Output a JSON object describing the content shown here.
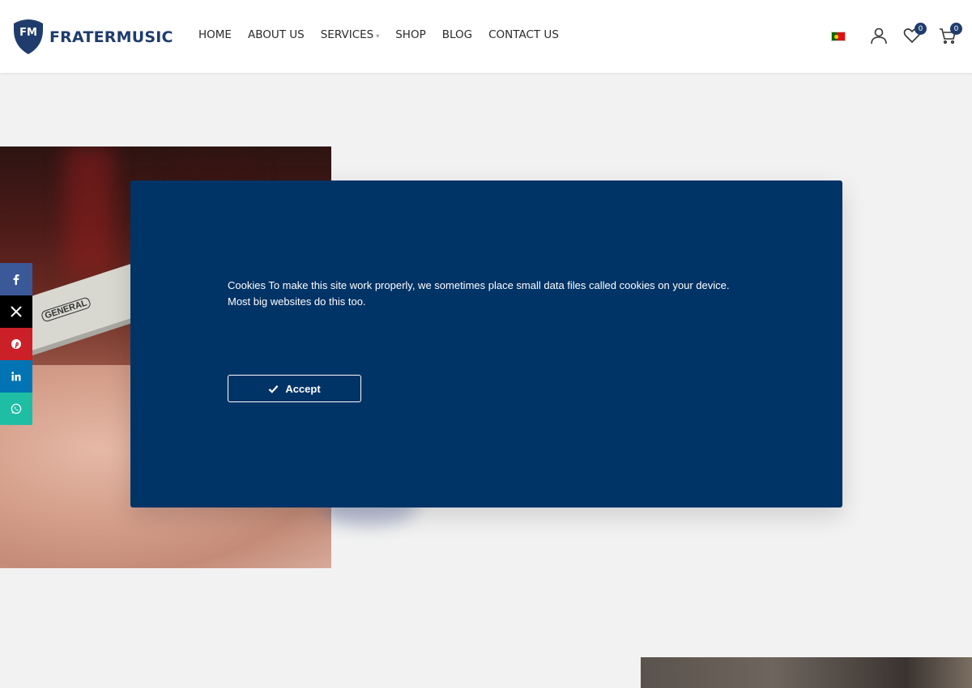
{
  "brand": {
    "name": "FRATERMUSIC",
    "mark": "FM",
    "color": "#1f3c6d"
  },
  "nav": {
    "items": [
      {
        "label": "HOME"
      },
      {
        "label": "ABOUT US"
      },
      {
        "label": "SERVICES",
        "has_dropdown": true
      },
      {
        "label": "SHOP"
      },
      {
        "label": "BLOG"
      },
      {
        "label": "CONTACT US"
      }
    ]
  },
  "header_icons": {
    "language_flag": "portugal-flag-icon",
    "account": "user-icon",
    "wishlist": {
      "icon": "heart-icon",
      "count": "0"
    },
    "cart": {
      "icon": "cart-icon",
      "count": "0"
    }
  },
  "social": [
    {
      "name": "facebook",
      "icon": "facebook-icon",
      "color": "#3b5998"
    },
    {
      "name": "x",
      "icon": "x-icon",
      "color": "#000000"
    },
    {
      "name": "pinterest",
      "icon": "pinterest-icon",
      "color": "#cb2027"
    },
    {
      "name": "linkedin",
      "icon": "linkedin-icon",
      "color": "#0274b3"
    },
    {
      "name": "whatsapp",
      "icon": "whatsapp-icon",
      "color": "#1ebea5"
    }
  ],
  "cookie_modal": {
    "text": "Cookies To make this site work properly, we sometimes place small data files called cookies on your device. Most big websites do this too.",
    "accept_label": "Accept",
    "background": "#003366"
  },
  "hero_photo": {
    "ruler_label": "GENERAL"
  }
}
